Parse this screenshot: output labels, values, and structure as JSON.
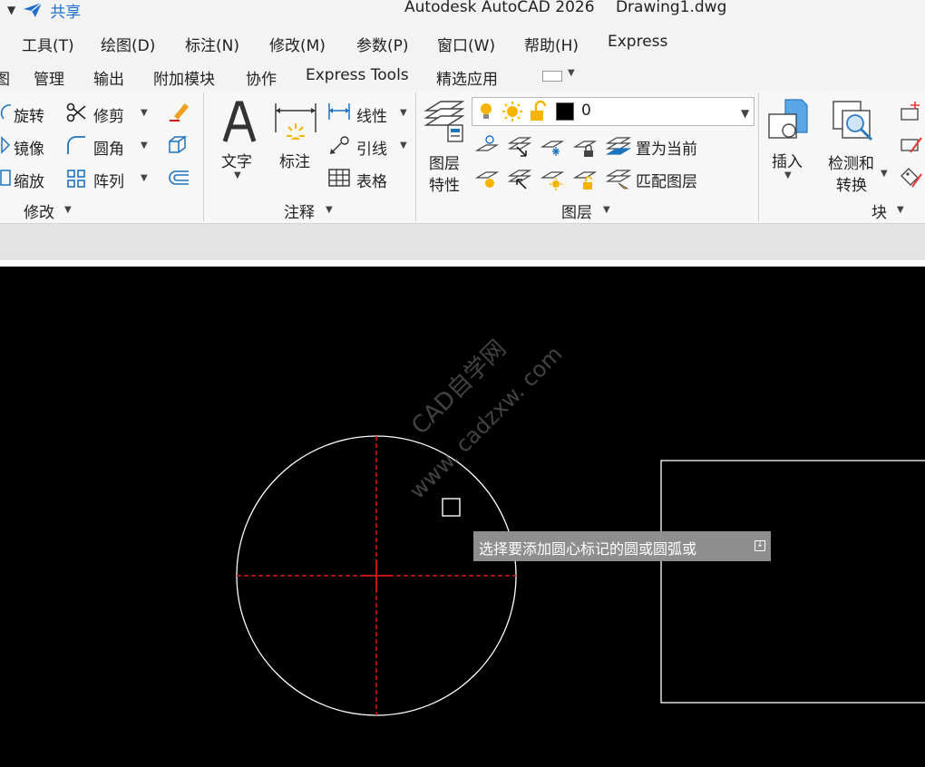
{
  "titlebar": {
    "share_label": "共享",
    "app_title": "Autodesk AutoCAD 2026",
    "file_name": "Drawing1.dwg"
  },
  "menu": [
    "工具(T)",
    "绘图(D)",
    "标注(N)",
    "修改(M)",
    "参数(P)",
    "窗口(W)",
    "帮助(H)",
    "Express"
  ],
  "tabs": [
    "图",
    "管理",
    "输出",
    "附加模块",
    "协作",
    "Express Tools",
    "精选应用"
  ],
  "modify_panel": {
    "title": "修改",
    "rotate": "旋转",
    "trim": "修剪",
    "mirror": "镜像",
    "fillet": "圆角",
    "scale": "缩放",
    "array": "阵列"
  },
  "annotation_panel": {
    "title": "注释",
    "text": "文字",
    "dimension": "标注",
    "linear": "线性",
    "leader": "引线",
    "table": "表格"
  },
  "layers_panel": {
    "title": "图层",
    "layer_properties": [
      "图层",
      "特性"
    ],
    "current_layer": "0",
    "set_current": "置为当前",
    "match_layer": "匹配图层"
  },
  "block_panel": {
    "title": "块",
    "insert": "插入",
    "detect_convert": [
      "检测和",
      "转换"
    ]
  },
  "canvas": {
    "watermark_cn": "CAD自学网",
    "watermark_url": "www. cadzxw. com",
    "tooltip_prompt": "选择要添加圆心标记的圆或圆弧或"
  },
  "colors": {
    "ribbon_bg": "#f7f7f7",
    "canvas_bg": "#000000",
    "centerline": "#d01515",
    "geometry": "#ffffff",
    "tooltip_bg": "#8e8e8e",
    "accent_blue": "#1f6fd1",
    "bulb_yellow": "#f5b400"
  }
}
